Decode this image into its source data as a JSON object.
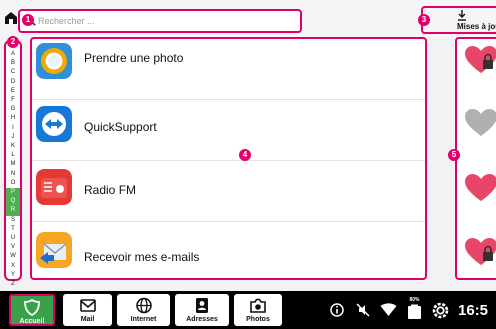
{
  "search": {
    "placeholder": "Rechercher ..."
  },
  "updates": {
    "label": "Mises à jour"
  },
  "callouts": [
    "1",
    "2",
    "3",
    "4",
    "5"
  ],
  "alphabet": [
    "A",
    "B",
    "C",
    "D",
    "E",
    "F",
    "G",
    "H",
    "I",
    "J",
    "K",
    "L",
    "M",
    "N",
    "O",
    "P",
    "Q",
    "R",
    "S",
    "T",
    "U",
    "V",
    "W",
    "X",
    "Y",
    "Z"
  ],
  "alphabet_highlight": [
    "P",
    "Q",
    "R"
  ],
  "apps": [
    {
      "label": "Prendre une photo",
      "icon": "camera-lens-icon"
    },
    {
      "label": "QuickSupport",
      "icon": "quicksupport-icon"
    },
    {
      "label": "Radio FM",
      "icon": "radio-icon"
    },
    {
      "label": "Recevoir mes e-mails",
      "icon": "email-receive-icon"
    }
  ],
  "favorites": [
    {
      "state": "locked-favorite",
      "icon": "heart-lock-icon"
    },
    {
      "state": "not-favorite",
      "icon": "heart-gray-icon"
    },
    {
      "state": "favorite",
      "icon": "heart-icon"
    },
    {
      "state": "locked-favorite",
      "icon": "heart-lock-icon"
    }
  ],
  "nav": [
    {
      "label": "Accueil",
      "icon": "home-shield-icon",
      "active": true
    },
    {
      "label": "Mail",
      "icon": "mail-icon"
    },
    {
      "label": "Internet",
      "icon": "globe-icon"
    },
    {
      "label": "Adresses",
      "icon": "contacts-icon"
    },
    {
      "label": "Photos",
      "icon": "camera-icon"
    }
  ],
  "status": {
    "battery": "80%",
    "time": "16:5"
  },
  "colors": {
    "accent": "#e1006a",
    "home": "#3aa14b",
    "heart": "#e8456a",
    "heart_off": "#b0b0b0"
  }
}
